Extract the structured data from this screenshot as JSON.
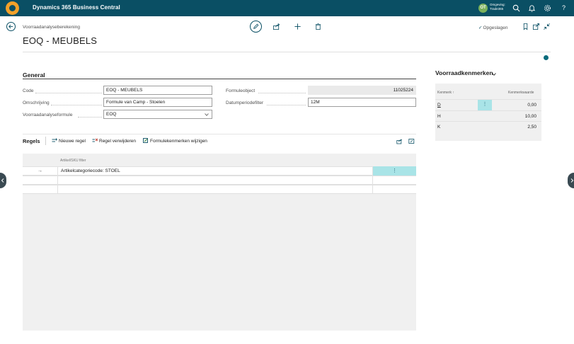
{
  "app": {
    "title": "Dynamics 365 Business Central",
    "environment_initials": "OT",
    "environment_line1": "Omgeving:",
    "environment_line2": "Trade365"
  },
  "header": {
    "breadcrumb": "Voorraadanalyseberekening",
    "title": "EOQ - MEUBELS",
    "saved_label": "Opgeslagen"
  },
  "general": {
    "section_title": "General",
    "fields": {
      "code": {
        "label": "Code",
        "value": "EOQ - MEUBELS"
      },
      "omschrijving": {
        "label": "Omschrijving",
        "value": "Formule van Camp - Stoelen"
      },
      "formule": {
        "label": "Voorraadanalyseformule",
        "value": "EOQ"
      },
      "formuleobject": {
        "label": "Formuleobject",
        "value": "11025224"
      },
      "datumperiodefilter": {
        "label": "Datumperiodefilter",
        "value": "12M"
      }
    }
  },
  "factbox": {
    "title": "Voorraadkenmerken",
    "col_key": "Kenmerk",
    "col_value": "Kenmerkwaarde",
    "sort_indicator": "↑",
    "rows": [
      {
        "key": "D",
        "value": "0,00"
      },
      {
        "key": "H",
        "value": "10,00"
      },
      {
        "key": "K",
        "value": "2,50"
      }
    ]
  },
  "lines": {
    "title": "Regels",
    "actions": {
      "new": "Nieuwe regel",
      "delete": "Regel verwijderen",
      "edit_props": "Formulekenmerken wijzigen"
    },
    "column_header": "Artikel/SKU filter",
    "rows": [
      {
        "arrow": "→",
        "filter": "Artikelcategoriecode: STOEL",
        "menu": "⋮"
      },
      {
        "arrow": "",
        "filter": "",
        "menu": ""
      },
      {
        "arrow": "",
        "filter": "",
        "menu": ""
      }
    ]
  },
  "colors": {
    "topbar": "#0a4f64",
    "accent": "#0a6b7c",
    "selection": "#a9e4e7"
  }
}
